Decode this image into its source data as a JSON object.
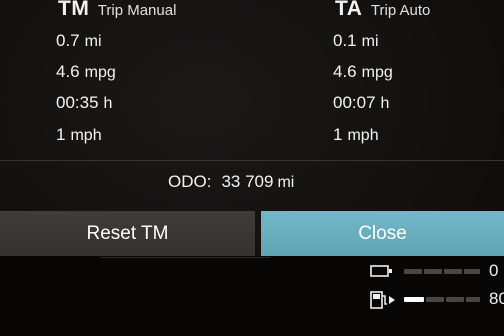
{
  "trip_manual": {
    "abbr": "TM",
    "name": "Trip Manual",
    "distance": "0.7",
    "distance_unit": "mi",
    "consumption": "4.6",
    "consumption_unit": "mpg",
    "time": "00:35",
    "time_unit": "h",
    "speed": "1",
    "speed_unit": "mph"
  },
  "trip_auto": {
    "abbr": "TA",
    "name": "Trip Auto",
    "distance": "0.1",
    "distance_unit": "mi",
    "consumption": "4.6",
    "consumption_unit": "mpg",
    "time": "00:07",
    "time_unit": "h",
    "speed": "1",
    "speed_unit": "mph"
  },
  "odometer": {
    "label": "ODO:",
    "value": "33 709",
    "unit": "mi"
  },
  "buttons": {
    "reset_label": "Reset TM",
    "close_label": "Close"
  },
  "status": {
    "battery": {
      "icon": "battery-icon",
      "value_text": "0"
    },
    "fuel": {
      "icon": "fuel-pump-icon",
      "value_text": "80"
    }
  },
  "colors": {
    "background": "#131110",
    "reset_button": "#3b3735",
    "close_button": "#68adbd",
    "text": "#f2f2f2"
  }
}
